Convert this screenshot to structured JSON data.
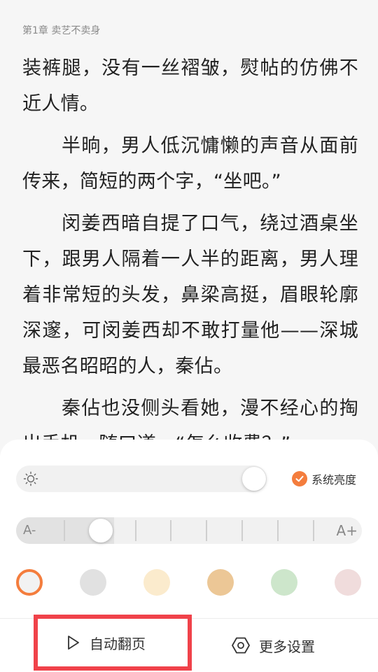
{
  "chapter_title": "第1章 卖艺不卖身",
  "paragraphs": [
    "装裤腿，没有一丝褶皱，熨帖的仿佛不近人情。",
    "半晌，男人低沉慵懒的声音从面前传来，简短的两个字，“坐吧。”",
    "闵姜西暗自提了口气，绕过酒桌坐下，跟男人隔着一人半的距离，男人理着非常短的头发，鼻梁高挺，眉眼轮廓深邃，可闵姜西却不敢打量他——深城最恶名昭昭的人，秦佔。",
    "秦佔也没侧头看她，漫不经心的掏出手机，随口道，“怎么收费？”"
  ],
  "settings_panel": {
    "brightness": {
      "level": 0.95,
      "icon": "sun-icon"
    },
    "system_brightness": {
      "checked": true,
      "label": "系统亮度"
    },
    "font_size": {
      "small_label": "A-",
      "large_label": "A+",
      "level_index": 1,
      "steps": 8
    },
    "theme_colors": [
      {
        "color": "#f2f2f2",
        "selected": true
      },
      {
        "color": "#e1e1e1",
        "selected": false
      },
      {
        "color": "#fbebcd",
        "selected": false
      },
      {
        "color": "#ecc796",
        "selected": false
      },
      {
        "color": "#cde6cb",
        "selected": false
      },
      {
        "color": "#f0dcdc",
        "selected": false
      }
    ],
    "auto_page": {
      "label": "自动翻页",
      "icon": "play-icon"
    },
    "more_settings": {
      "label": "更多设置",
      "icon": "hexagon-settings-icon"
    }
  },
  "accent_color": "#f47d3d"
}
